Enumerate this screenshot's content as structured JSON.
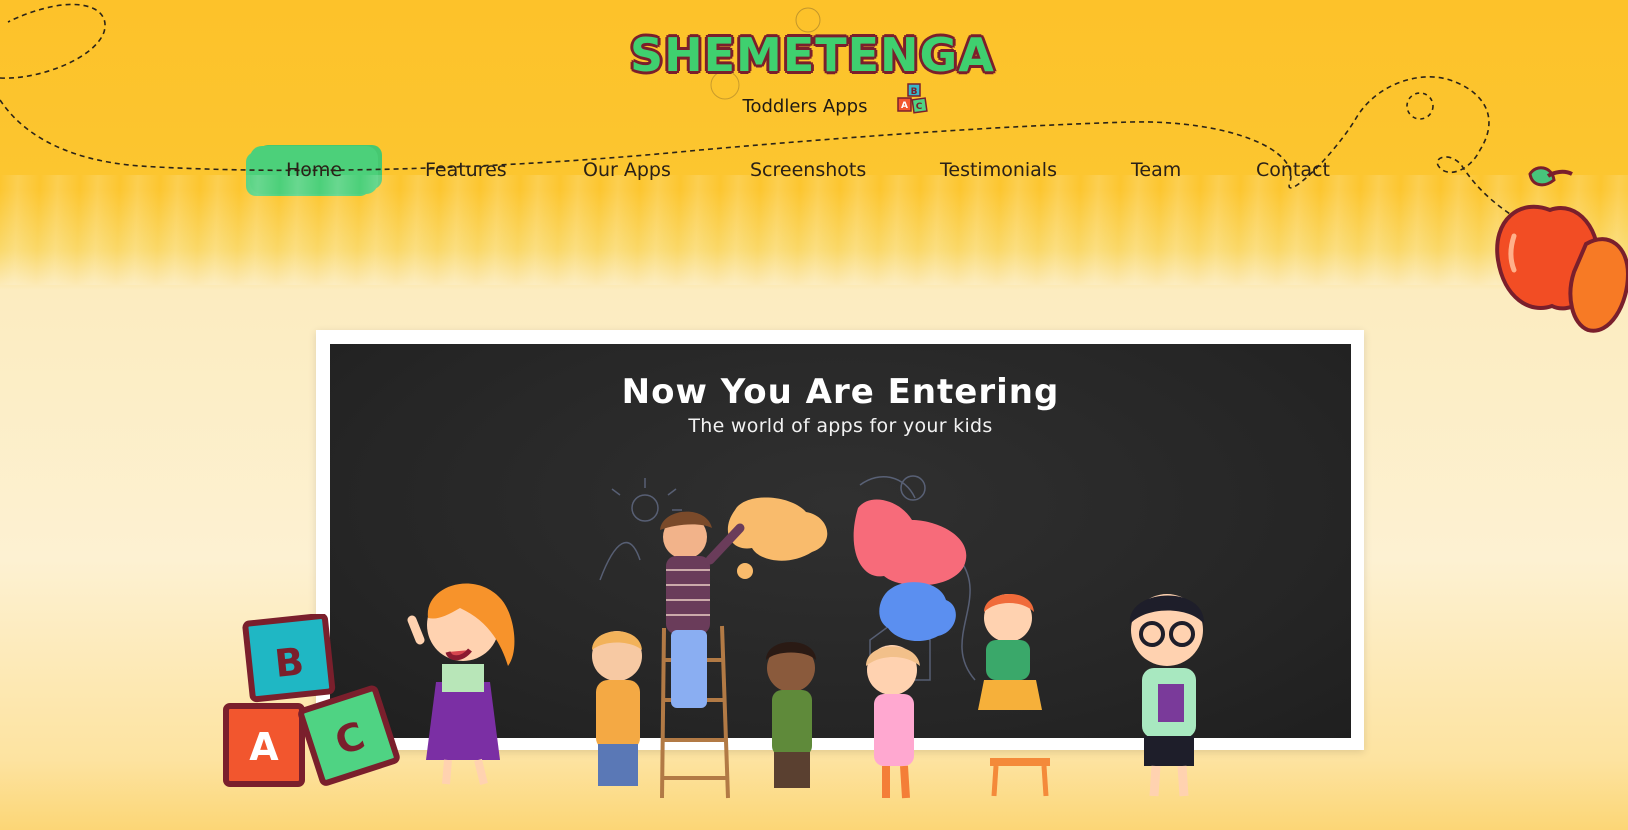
{
  "brand": {
    "name": "SHEMETENGA",
    "tagline": "Toddlers Apps",
    "block_letters": [
      "A",
      "B",
      "C"
    ]
  },
  "nav": {
    "items": [
      {
        "label": "Home",
        "active": true
      },
      {
        "label": "Features",
        "active": false
      },
      {
        "label": "Our Apps",
        "active": false
      },
      {
        "label": "Screenshots",
        "active": false
      },
      {
        "label": "Testimonials",
        "active": false
      },
      {
        "label": "Team",
        "active": false
      },
      {
        "label": "Contact",
        "active": false
      }
    ]
  },
  "hero": {
    "title": "Now You Are Entering",
    "subtitle": "The world of apps for your kids"
  },
  "colors": {
    "background_top": "#fdc22a",
    "background_bottom": "#fdf1d2",
    "logo_fill": "#3fd06f",
    "logo_outline": "#7a1f2c",
    "nav_active": "#4cd07a",
    "chalkboard": "#262626",
    "frame": "#ffffff"
  },
  "icons": {
    "blocks": "abc-blocks-icon",
    "apple": "apple-icon",
    "mini_blocks": "mini-abc-blocks-icon"
  }
}
